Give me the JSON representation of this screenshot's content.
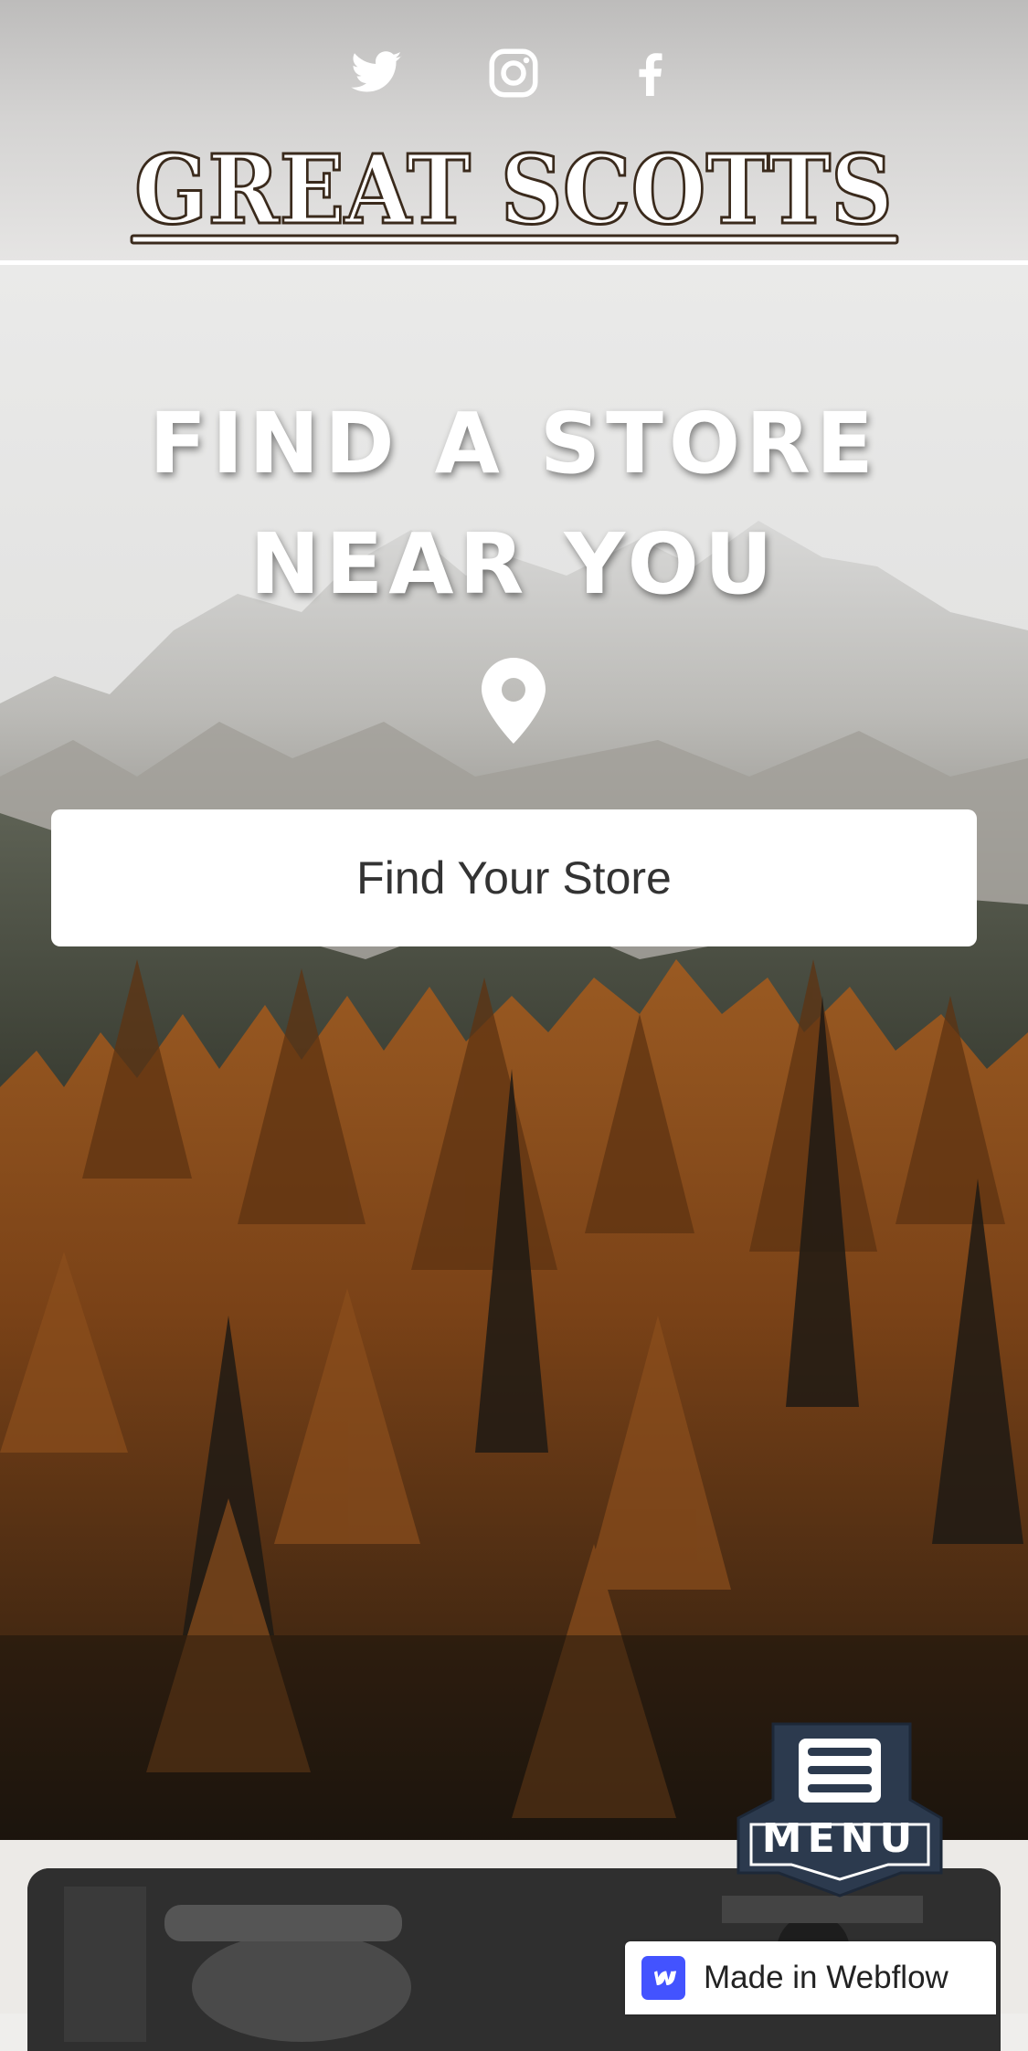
{
  "header": {
    "social": [
      {
        "icon": "twitter-icon"
      },
      {
        "icon": "instagram-icon"
      },
      {
        "icon": "facebook-icon"
      }
    ],
    "logo_text": "GREAT SCOTTS",
    "logo_colors": {
      "fill": "#ffffff",
      "outline": "#3a2a1c",
      "underline": "#3a2a1c"
    }
  },
  "hero": {
    "title_line1": "FIND A STORE",
    "title_line2": "NEAR YOU",
    "pin_icon": "map-pin-icon",
    "cta_label": "Find Your Store"
  },
  "menu_badge": {
    "icon": "hamburger-icon",
    "label": "MENU",
    "color": "#2c3a4e"
  },
  "webflow_badge": {
    "icon": "webflow-icon",
    "label": "Made in Webflow",
    "accent": "#4353ff"
  }
}
